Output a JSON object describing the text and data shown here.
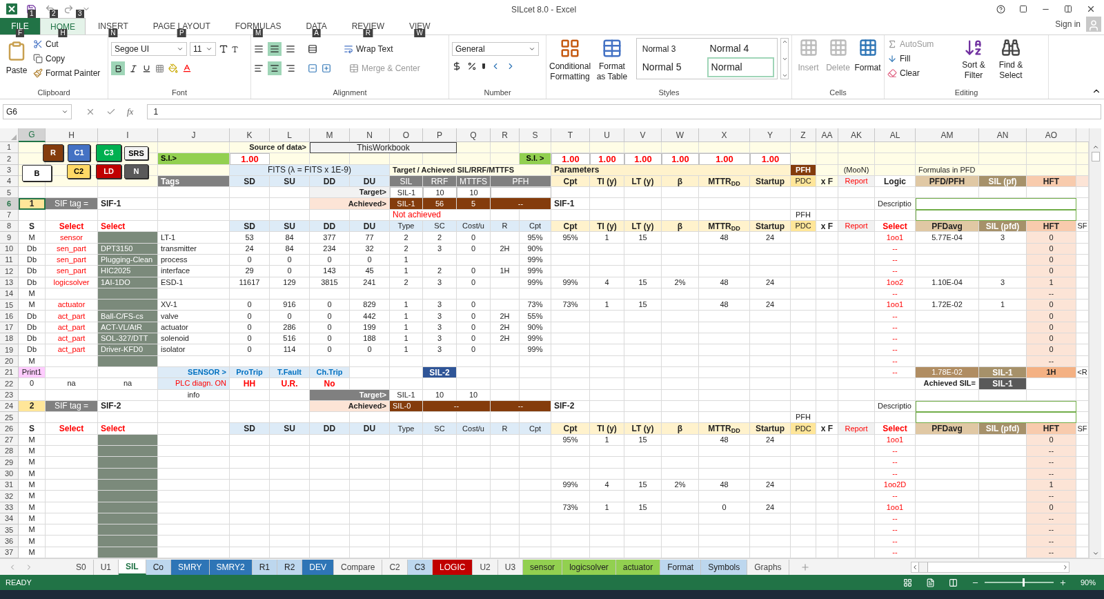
{
  "window": {
    "title": "SILcet 8.0 - Excel",
    "sign_in": "Sign in",
    "quick_access_keytips": [
      "1",
      "2",
      "3"
    ]
  },
  "tabs": [
    {
      "label": "FILE",
      "keytip": "F",
      "kind": "file",
      "selected": false
    },
    {
      "label": "HOME",
      "keytip": "H",
      "kind": "tab",
      "selected": true
    },
    {
      "label": "INSERT",
      "keytip": "N",
      "kind": "tab",
      "selected": false
    },
    {
      "label": "PAGE LAYOUT",
      "keytip": "P",
      "kind": "tab",
      "selected": false
    },
    {
      "label": "FORMULAS",
      "keytip": "M",
      "kind": "tab",
      "selected": false
    },
    {
      "label": "DATA",
      "keytip": "A",
      "kind": "tab",
      "selected": false
    },
    {
      "label": "REVIEW",
      "keytip": "R",
      "kind": "tab",
      "selected": false
    },
    {
      "label": "VIEW",
      "keytip": "W",
      "kind": "tab",
      "selected": false
    }
  ],
  "ribbon": {
    "clipboard": {
      "label": "Clipboard",
      "paste": "Paste",
      "cut": "Cut",
      "copy": "Copy",
      "format_painter": "Format Painter"
    },
    "font": {
      "label": "Font",
      "family": "Segoe UI",
      "size": "11",
      "bold": true
    },
    "alignment": {
      "label": "Alignment",
      "wrap_text": "Wrap Text",
      "merge": "Merge & Center",
      "middle": true,
      "center": true
    },
    "number": {
      "label": "Number",
      "format": "General"
    },
    "styles": {
      "label": "Styles",
      "conditional": "Conditional Formatting",
      "format_table": "Format as Table",
      "items": [
        {
          "label": "Normal 3",
          "selected": false
        },
        {
          "label": "Normal 4",
          "selected": false
        },
        {
          "label": "Normal 5",
          "selected": false
        },
        {
          "label": "Normal",
          "selected": true
        }
      ]
    },
    "cells": {
      "label": "Cells",
      "items": [
        {
          "label": "Insert",
          "disabled": true
        },
        {
          "label": "Delete",
          "disabled": true
        },
        {
          "label": "Format",
          "disabled": false
        }
      ]
    },
    "editing": {
      "label": "Editing",
      "autosum": "AutoSum",
      "fill": "Fill",
      "clear": "Clear",
      "sort": "Sort & Filter",
      "find": "Find & Select"
    }
  },
  "formula_bar": {
    "name_box": "G6",
    "function_label": "fx",
    "value": "1"
  },
  "columns": [
    {
      "letter": "G",
      "selected": true
    },
    {
      "letter": "H",
      "selected": false
    },
    {
      "letter": "I",
      "selected": false
    },
    {
      "letter": "J",
      "selected": false
    },
    {
      "letter": "K",
      "selected": false
    },
    {
      "letter": "L",
      "selected": false
    },
    {
      "letter": "M",
      "selected": false
    },
    {
      "letter": "N",
      "selected": false
    },
    {
      "letter": "O",
      "selected": false
    },
    {
      "letter": "P",
      "selected": false
    },
    {
      "letter": "Q",
      "selected": false
    },
    {
      "letter": "R",
      "selected": false
    },
    {
      "letter": "S",
      "selected": false
    },
    {
      "letter": "T",
      "selected": false
    },
    {
      "letter": "U",
      "selected": false
    },
    {
      "letter": "V",
      "selected": false
    },
    {
      "letter": "W",
      "selected": false
    },
    {
      "letter": "X",
      "selected": false
    },
    {
      "letter": "Y",
      "selected": false
    },
    {
      "letter": "Z",
      "selected": false
    },
    {
      "letter": "AA",
      "selected": false
    },
    {
      "letter": "AK",
      "selected": false
    },
    {
      "letter": "AL",
      "selected": false
    },
    {
      "letter": "AM",
      "selected": false
    },
    {
      "letter": "AN",
      "selected": false
    },
    {
      "letter": "AO",
      "selected": false
    }
  ],
  "sheet_buttons": [
    {
      "label": "R",
      "color": "#843c0c"
    },
    {
      "label": "C1",
      "color": "#4472c4"
    },
    {
      "label": "C3",
      "color": "#00b050"
    },
    {
      "label": "SRS",
      "color": "#f2f2f2"
    },
    {
      "label": "B",
      "color": "#ffffff"
    },
    {
      "label": "C2",
      "color": "#ffd966"
    },
    {
      "label": "LD",
      "color": "#c00000"
    },
    {
      "label": "N",
      "color": "#595959"
    }
  ],
  "rows": [
    {
      "n": "1",
      "kind": "banner",
      "selected": false,
      "cells": [
        null,
        null,
        null,
        null,
        {
          "text": "Source of data>",
          "kind": "right"
        },
        {
          "kind": "cont"
        },
        {
          "text": "ThisWorkbook",
          "kind": "box"
        },
        {
          "kind": "cont"
        },
        {
          "kind": "cont"
        },
        {
          "kind": "cont"
        }
      ]
    },
    {
      "n": "2",
      "kind": "banner",
      "selected": false,
      "cells": [
        null,
        null,
        null,
        {
          "text": "S.I.>",
          "kind": "green"
        },
        {
          "text": "1.00",
          "kind": "input"
        },
        null,
        null,
        null,
        null,
        null,
        null,
        null,
        {
          "text": "S.I. >",
          "kind": "green"
        },
        {
          "text": "1.00",
          "kind": "input"
        },
        {
          "text": "1.00",
          "kind": "input"
        },
        {
          "text": "1.00",
          "kind": "input"
        },
        {
          "text": "1.00",
          "kind": "input"
        },
        {
          "text": "1.00",
          "kind": "input"
        },
        {
          "text": "1.00",
          "kind": "input"
        }
      ]
    },
    {
      "n": "3",
      "kind": "banner",
      "selected": false,
      "cells": [
        null,
        null,
        null,
        null,
        {
          "text": "FITS  (λ = FITS x 1E-9)",
          "kind": "fits"
        },
        {
          "kind": "cont"
        },
        {
          "kind": "cont"
        },
        {
          "kind": "cont"
        },
        {
          "text": "Target / Achieved SIL/RRF/MTTFS",
          "kind": "boldsmall"
        },
        {
          "kind": "cont"
        },
        {
          "kind": "cont"
        },
        {
          "kind": "cont"
        },
        {
          "kind": "cont"
        },
        {
          "text": "Parameters",
          "kind": "creamleft"
        },
        {
          "kind": "cont"
        },
        {
          "kind": "cont"
        },
        {
          "kind": "cont"
        },
        {
          "kind": "cont"
        },
        {
          "kind": "cont"
        },
        {
          "text": "PFH",
          "kind": "brownbold"
        },
        null,
        {
          "text": "(MooN)",
          "kind": "small"
        },
        null,
        {
          "text": "Formulas in PFD",
          "kind": "smallleft"
        },
        {
          "kind": "cont"
        }
      ]
    },
    {
      "n": "4",
      "kind": "banner",
      "selected": false,
      "cells": [
        null,
        null,
        null,
        {
          "text": "Tags",
          "kind": "dark"
        },
        {
          "text": "SD",
          "kind": "hdr"
        },
        {
          "text": "SU",
          "kind": "hdr"
        },
        {
          "text": "DD",
          "kind": "hdr"
        },
        {
          "text": "DU",
          "kind": "hdr"
        },
        {
          "text": "SIL",
          "kind": "ghdr"
        },
        {
          "text": "RRF",
          "kind": "ghdr"
        },
        {
          "text": "MTTFS",
          "kind": "ghdr"
        },
        {
          "text": "PFH",
          "kind": "ghdr"
        },
        {
          "kind": "cont"
        },
        {
          "text": "Cpt",
          "kind": "cream"
        },
        {
          "text": "TI (y)",
          "kind": "cream"
        },
        {
          "text": "LT (y)",
          "kind": "cream"
        },
        {
          "text": "β",
          "kind": "cream"
        },
        {
          "text": "MTTR$_{DD}$",
          "kind": "cream"
        },
        {
          "text": "Startup",
          "kind": "cream"
        },
        {
          "text": "PDC",
          "kind": "pdc"
        },
        {
          "text": "x F",
          "kind": "bold"
        },
        {
          "text": "Report",
          "kind": "report"
        },
        {
          "text": "Logic",
          "kind": "boldwhite"
        },
        {
          "text": "PFD/PFH",
          "kind": "tan"
        },
        {
          "text": "SIL (pf)",
          "kind": "olive"
        },
        {
          "text": "HFT",
          "kind": "salmon"
        },
        {
          "kind": "pale"
        }
      ]
    },
    {
      "n": "5",
      "kind": "plain",
      "selected": false,
      "cells": [
        null,
        null,
        null,
        null,
        null,
        null,
        {
          "text": "Target>",
          "kind": "graylabel"
        },
        {
          "kind": "cont"
        },
        {
          "text": "SIL-1",
          "kind": "boxed"
        },
        {
          "text": "10",
          "kind": "boxed"
        },
        {
          "text": "10",
          "kind": "boxed"
        },
        {
          "kind": "boxed"
        },
        {
          "kind": "cont"
        }
      ]
    },
    {
      "n": "6",
      "kind": "plain",
      "selected": true,
      "cells": [
        {
          "text": "1",
          "kind": "num"
        },
        {
          "text": "SIF tag =",
          "kind": "darklabel"
        },
        {
          "text": "SIF-1",
          "kind": "boldleft"
        },
        null,
        null,
        null,
        {
          "text": "Achieved>",
          "kind": "peach"
        },
        {
          "kind": "cont"
        },
        {
          "text": "SIL-1",
          "kind": "brown"
        },
        {
          "text": "56",
          "kind": "brown"
        },
        {
          "text": "5",
          "kind": "brown"
        },
        {
          "text": "--",
          "kind": "brown"
        },
        {
          "kind": "cont"
        },
        {
          "text": "SIF-1",
          "kind": "boldleft"
        },
        null,
        null,
        null,
        null,
        null,
        null,
        null,
        null,
        {
          "text": "Descriptio",
          "kind": "smallleft"
        },
        {
          "kind": "descbox"
        },
        {
          "kind": "cont"
        },
        {
          "kind": "cont"
        }
      ]
    },
    {
      "n": "7",
      "kind": "plain",
      "selected": false,
      "cells": [
        null,
        null,
        null,
        null,
        null,
        null,
        null,
        null,
        {
          "text": "Not achieved",
          "kind": "redleft"
        },
        {
          "kind": "cont"
        },
        {
          "kind": "cont"
        },
        null,
        null,
        null,
        null,
        null,
        null,
        null,
        null,
        {
          "text": "PFH",
          "kind": "small"
        },
        null,
        null,
        null,
        {
          "kind": "descbox"
        },
        {
          "kind": "cont"
        },
        {
          "kind": "cont"
        }
      ]
    },
    {
      "n": "8",
      "kind": "plain",
      "selected": false,
      "cells": [
        {
          "text": "S",
          "kind": "bold"
        },
        {
          "text": "Select",
          "kind": "redbold"
        },
        {
          "text": "Select",
          "kind": "redbold"
        },
        null,
        {
          "text": "SD",
          "kind": "hdr"
        },
        {
          "text": "SU",
          "kind": "hdr"
        },
        {
          "text": "DD",
          "kind": "hdr"
        },
        {
          "text": "DU",
          "kind": "hdr"
        },
        {
          "text": "Type",
          "kind": "hdrplain"
        },
        {
          "text": "SC",
          "kind": "hdrplain"
        },
        {
          "text": "Cost/u",
          "kind": "hdrplain"
        },
        {
          "text": "R",
          "kind": "hdrplain"
        },
        {
          "text": "Cpt",
          "kind": "hdrplain"
        },
        {
          "text": "Cpt",
          "kind": "cream"
        },
        {
          "text": "TI (y)",
          "kind": "cream"
        },
        {
          "text": "LT (y)",
          "kind": "cream"
        },
        {
          "text": "β",
          "kind": "cream"
        },
        {
          "text": "MTTR$_{DD}$",
          "kind": "cream"
        },
        {
          "text": "Startup",
          "kind": "cream"
        },
        {
          "text": "PDC",
          "kind": "pdc"
        },
        {
          "text": "x F",
          "kind": "bold"
        },
        {
          "text": "Report",
          "kind": "report"
        },
        {
          "text": "Select",
          "kind": "redbold"
        },
        {
          "text": "PFDavg",
          "kind": "tan"
        },
        {
          "text": "SIL (pfd)",
          "kind": "olive"
        },
        {
          "text": "HFT",
          "kind": "salmon"
        },
        {
          "text": "SF",
          "kind": "small"
        }
      ]
    },
    {
      "n": "9",
      "kind": "plain",
      "selected": false,
      "cells": [
        "M",
        {
          "text": "sensor",
          "kind": "red"
        },
        {
          "kind": "shade"
        },
        "LT-1",
        "53",
        "84",
        "377",
        "77",
        "2",
        "2",
        "0",
        null,
        "95%",
        "95%",
        "1",
        "15",
        null,
        "48",
        "24",
        null,
        null,
        null,
        {
          "text": "1oo1",
          "kind": "red"
        },
        "5.77E-04",
        "3",
        {
          "text": "0",
          "kind": "pale"
        }
      ]
    },
    {
      "n": "10",
      "kind": "plain",
      "selected": false,
      "cells": [
        "Db",
        {
          "text": "sen_part",
          "kind": "red"
        },
        {
          "text": "DPT3150",
          "kind": "shade"
        },
        "transmitter",
        "24",
        "84",
        "234",
        "32",
        "2",
        "3",
        "0",
        "2H",
        "90%",
        null,
        null,
        null,
        null,
        null,
        null,
        null,
        null,
        null,
        {
          "text": "--",
          "kind": "red"
        },
        null,
        null,
        {
          "text": "0",
          "kind": "pale"
        }
      ]
    },
    {
      "n": "11",
      "kind": "plain",
      "selected": false,
      "cells": [
        "Db",
        {
          "text": "sen_part",
          "kind": "red"
        },
        {
          "text": "Plugging-Clean",
          "kind": "shade"
        },
        "process",
        "0",
        "0",
        "0",
        "0",
        "1",
        null,
        null,
        null,
        "99%",
        null,
        null,
        null,
        null,
        null,
        null,
        null,
        null,
        null,
        {
          "text": "--",
          "kind": "red"
        },
        null,
        null,
        {
          "text": "0",
          "kind": "pale"
        }
      ]
    },
    {
      "n": "12",
      "kind": "plain",
      "selected": false,
      "cells": [
        "Db",
        {
          "text": "sen_part",
          "kind": "red"
        },
        {
          "text": "HIC2025",
          "kind": "shade"
        },
        "interface",
        "29",
        "0",
        "143",
        "45",
        "1",
        "2",
        "0",
        "1H",
        "99%",
        null,
        null,
        null,
        null,
        null,
        null,
        null,
        null,
        null,
        {
          "text": "--",
          "kind": "red"
        },
        null,
        null,
        {
          "text": "0",
          "kind": "pale"
        }
      ]
    },
    {
      "n": "13",
      "kind": "plain",
      "selected": false,
      "cells": [
        "Db",
        {
          "text": "logicsolver",
          "kind": "red"
        },
        {
          "text": "1AI-1DO",
          "kind": "shade"
        },
        "ESD-1",
        "11617",
        "129",
        "3815",
        "241",
        "2",
        "3",
        "0",
        null,
        "99%",
        "99%",
        "4",
        "15",
        "2%",
        "48",
        "24",
        null,
        null,
        null,
        {
          "text": "1oo2",
          "kind": "red"
        },
        "1.10E-04",
        "3",
        {
          "text": "1",
          "kind": "pale"
        }
      ]
    },
    {
      "n": "14",
      "kind": "plain",
      "selected": false,
      "cells": [
        "M",
        null,
        {
          "kind": "shade"
        },
        null,
        null,
        null,
        null,
        null,
        null,
        null,
        null,
        null,
        null,
        null,
        null,
        null,
        null,
        null,
        null,
        null,
        null,
        null,
        {
          "text": "--",
          "kind": "red"
        },
        null,
        null,
        {
          "text": "--",
          "kind": "pale"
        }
      ]
    },
    {
      "n": "15",
      "kind": "plain",
      "selected": false,
      "cells": [
        "M",
        {
          "text": "actuator",
          "kind": "red"
        },
        {
          "kind": "shade"
        },
        "XV-1",
        "0",
        "916",
        "0",
        "829",
        "1",
        "3",
        "0",
        null,
        "73%",
        "73%",
        "1",
        "15",
        null,
        "48",
        "24",
        null,
        null,
        null,
        {
          "text": "1oo1",
          "kind": "red"
        },
        "1.72E-02",
        "1",
        {
          "text": "0",
          "kind": "pale"
        }
      ]
    },
    {
      "n": "16",
      "kind": "plain",
      "selected": false,
      "cells": [
        "Db",
        {
          "text": "act_part",
          "kind": "red"
        },
        {
          "text": "Ball-C/FS-cs",
          "kind": "shade"
        },
        "valve",
        "0",
        "0",
        "0",
        "442",
        "1",
        "3",
        "0",
        "2H",
        "55%",
        null,
        null,
        null,
        null,
        null,
        null,
        null,
        null,
        null,
        {
          "text": "--",
          "kind": "red"
        },
        null,
        null,
        {
          "text": "0",
          "kind": "pale"
        }
      ]
    },
    {
      "n": "17",
      "kind": "plain",
      "selected": false,
      "cells": [
        "Db",
        {
          "text": "act_part",
          "kind": "red"
        },
        {
          "text": "ACT-VL/AtR",
          "kind": "shade"
        },
        "actuator",
        "0",
        "286",
        "0",
        "199",
        "1",
        "3",
        "0",
        "2H",
        "90%",
        null,
        null,
        null,
        null,
        null,
        null,
        null,
        null,
        null,
        {
          "text": "--",
          "kind": "red"
        },
        null,
        null,
        {
          "text": "0",
          "kind": "pale"
        }
      ]
    },
    {
      "n": "18",
      "kind": "plain",
      "selected": false,
      "cells": [
        "Db",
        {
          "text": "act_part",
          "kind": "red"
        },
        {
          "text": "SOL-327/DTT",
          "kind": "shade"
        },
        "solenoid",
        "0",
        "516",
        "0",
        "188",
        "1",
        "3",
        "0",
        "2H",
        "99%",
        null,
        null,
        null,
        null,
        null,
        null,
        null,
        null,
        null,
        {
          "text": "--",
          "kind": "red"
        },
        null,
        null,
        {
          "text": "0",
          "kind": "pale"
        }
      ]
    },
    {
      "n": "19",
      "kind": "plain",
      "selected": false,
      "cells": [
        "Db",
        {
          "text": "act_part",
          "kind": "red"
        },
        {
          "text": "Driver-KFD0",
          "kind": "shade"
        },
        "isolator",
        "0",
        "114",
        "0",
        "0",
        "1",
        "3",
        "0",
        null,
        "99%",
        null,
        null,
        null,
        null,
        null,
        null,
        null,
        null,
        null,
        {
          "text": "--",
          "kind": "red"
        },
        null,
        null,
        {
          "text": "0",
          "kind": "pale"
        }
      ]
    },
    {
      "n": "20",
      "kind": "plain",
      "selected": false,
      "cells": [
        "M",
        null,
        {
          "kind": "shade"
        },
        null,
        null,
        null,
        null,
        null,
        null,
        null,
        null,
        null,
        null,
        null,
        null,
        null,
        null,
        null,
        null,
        null,
        null,
        null,
        {
          "text": "--",
          "kind": "red"
        },
        null,
        null,
        {
          "text": "--",
          "kind": "pale"
        }
      ]
    },
    {
      "n": "21",
      "kind": "plain",
      "selected": false,
      "cells": [
        {
          "text": "Print1",
          "kind": "pink"
        },
        null,
        null,
        {
          "text": "SENSOR >",
          "kind": "blueright"
        },
        {
          "text": "ProTrip",
          "kind": "blue"
        },
        {
          "text": "T.Fault",
          "kind": "blue"
        },
        {
          "text": "Ch.Trip",
          "kind": "blue"
        },
        null,
        null,
        {
          "text": "SIL-2",
          "kind": "navy"
        },
        null,
        null,
        null,
        null,
        null,
        null,
        null,
        null,
        null,
        null,
        null,
        null,
        {
          "text": "--",
          "kind": "red"
        },
        {
          "text": "1.78E-02",
          "kind": "sum"
        },
        {
          "text": "SIL-1",
          "kind": "olive"
        },
        {
          "text": "1H",
          "kind": "salmonbar"
        },
        {
          "text": "<R",
          "kind": "small"
        }
      ]
    },
    {
      "n": "22",
      "kind": "plain",
      "selected": false,
      "cells": [
        "0",
        "na",
        {
          "text": "na",
          "kind": "center"
        },
        {
          "text": "PLC diagn. ON",
          "kind": "redright"
        },
        {
          "text": "HH",
          "kind": "redbold"
        },
        {
          "text": "U.R.",
          "kind": "redbold"
        },
        {
          "text": "No",
          "kind": "redbold"
        },
        null,
        null,
        null,
        null,
        null,
        null,
        null,
        null,
        null,
        null,
        null,
        null,
        null,
        null,
        null,
        null,
        {
          "text": "Achieved SIL=",
          "kind": "right"
        },
        {
          "text": "SIL-1",
          "kind": "achv"
        }
      ]
    },
    {
      "n": "23",
      "kind": "plain",
      "selected": false,
      "cells": [
        null,
        null,
        null,
        {
          "text": "info",
          "kind": "center"
        },
        null,
        null,
        {
          "text": "Target>",
          "kind": "darkright"
        },
        {
          "kind": "cont"
        },
        "SIL-1",
        "10",
        "10"
      ]
    },
    {
      "n": "24",
      "kind": "plain",
      "selected": false,
      "cells": [
        {
          "text": "2",
          "kind": "num"
        },
        {
          "text": "SIF tag =",
          "kind": "darklabel"
        },
        {
          "text": "SIF-2",
          "kind": "boldleft"
        },
        null,
        null,
        null,
        {
          "text": "Achieved>",
          "kind": "peach"
        },
        {
          "kind": "cont"
        },
        {
          "text": "SIL-0",
          "kind": "brownleft"
        },
        {
          "text": "--",
          "kind": "brown"
        },
        {
          "kind": "cont"
        },
        {
          "text": "--",
          "kind": "brown"
        },
        {
          "kind": "cont"
        },
        {
          "text": "SIF-2",
          "kind": "boldleft"
        },
        null,
        null,
        null,
        null,
        null,
        null,
        null,
        null,
        {
          "text": "Descriptio",
          "kind": "smallleft"
        },
        {
          "kind": "descbox"
        },
        {
          "kind": "cont"
        },
        {
          "kind": "cont"
        }
      ]
    },
    {
      "n": "25",
      "kind": "plain",
      "selected": false,
      "cells": [
        null,
        null,
        null,
        null,
        null,
        null,
        null,
        null,
        null,
        null,
        null,
        null,
        null,
        null,
        null,
        null,
        null,
        null,
        null,
        {
          "text": "PFH",
          "kind": "small"
        },
        null,
        null,
        null,
        {
          "kind": "descbox"
        },
        {
          "kind": "cont"
        },
        {
          "kind": "cont"
        }
      ]
    },
    {
      "n": "26",
      "kind": "plain",
      "selected": false,
      "cells": [
        {
          "text": "S",
          "kind": "bold"
        },
        {
          "text": "Select",
          "kind": "redbold"
        },
        {
          "text": "Select",
          "kind": "redbold"
        },
        null,
        {
          "text": "SD",
          "kind": "hdr"
        },
        {
          "text": "SU",
          "kind": "hdr"
        },
        {
          "text": "DD",
          "kind": "hdr"
        },
        {
          "text": "DU",
          "kind": "hdr"
        },
        {
          "text": "Type",
          "kind": "hdrplain"
        },
        {
          "text": "SC",
          "kind": "hdrplain"
        },
        {
          "text": "Cost/u",
          "kind": "hdrplain"
        },
        {
          "text": "R",
          "kind": "hdrplain"
        },
        {
          "text": "Cpt",
          "kind": "hdrplain"
        },
        {
          "text": "Cpt",
          "kind": "cream"
        },
        {
          "text": "TI (y)",
          "kind": "cream"
        },
        {
          "text": "LT (y)",
          "kind": "cream"
        },
        {
          "text": "β",
          "kind": "cream"
        },
        {
          "text": "MTTR$_{DD}$",
          "kind": "cream"
        },
        {
          "text": "Startup",
          "kind": "cream"
        },
        {
          "text": "PDC",
          "kind": "pdc"
        },
        {
          "text": "x F",
          "kind": "bold"
        },
        {
          "text": "Report",
          "kind": "report"
        },
        {
          "text": "Select",
          "kind": "redbold"
        },
        {
          "text": "PFDavg",
          "kind": "tan"
        },
        {
          "text": "SIL (pfd)",
          "kind": "olive"
        },
        {
          "text": "HFT",
          "kind": "salmon"
        },
        {
          "text": "SF",
          "kind": "small"
        }
      ]
    },
    {
      "n": "27",
      "kind": "plain",
      "selected": false,
      "cells": [
        "M",
        null,
        {
          "kind": "shade"
        },
        null,
        null,
        null,
        null,
        null,
        null,
        null,
        null,
        null,
        null,
        "95%",
        "1",
        "15",
        null,
        "48",
        "24",
        null,
        null,
        null,
        {
          "text": "1oo1",
          "kind": "red"
        },
        null,
        null,
        {
          "text": "0",
          "kind": "pale"
        }
      ]
    },
    {
      "n": "28",
      "kind": "plain",
      "selected": false,
      "cells": [
        "M",
        null,
        {
          "kind": "shade"
        },
        null,
        null,
        null,
        null,
        null,
        null,
        null,
        null,
        null,
        null,
        null,
        null,
        null,
        null,
        null,
        null,
        null,
        null,
        null,
        {
          "text": "--",
          "kind": "red"
        },
        null,
        null,
        {
          "text": "--",
          "kind": "pale"
        }
      ]
    },
    {
      "n": "29",
      "kind": "plain",
      "selected": false,
      "cells": [
        "M",
        null,
        {
          "kind": "shade"
        },
        null,
        null,
        null,
        null,
        null,
        null,
        null,
        null,
        null,
        null,
        null,
        null,
        null,
        null,
        null,
        null,
        null,
        null,
        null,
        {
          "text": "--",
          "kind": "red"
        },
        null,
        null,
        {
          "text": "--",
          "kind": "pale"
        }
      ]
    },
    {
      "n": "30",
      "kind": "plain",
      "selected": false,
      "cells": [
        "M",
        null,
        {
          "kind": "shade"
        },
        null,
        null,
        null,
        null,
        null,
        null,
        null,
        null,
        null,
        null,
        null,
        null,
        null,
        null,
        null,
        null,
        null,
        null,
        null,
        {
          "text": "--",
          "kind": "red"
        },
        null,
        null,
        {
          "text": "--",
          "kind": "pale"
        }
      ]
    },
    {
      "n": "31",
      "kind": "plain",
      "selected": false,
      "cells": [
        "M",
        null,
        {
          "kind": "shade"
        },
        null,
        null,
        null,
        null,
        null,
        null,
        null,
        null,
        null,
        null,
        "99%",
        "4",
        "15",
        "2%",
        "48",
        "24",
        null,
        null,
        null,
        {
          "text": "1oo2D",
          "kind": "red"
        },
        null,
        null,
        {
          "text": "1",
          "kind": "pale"
        }
      ]
    },
    {
      "n": "32",
      "kind": "plain",
      "selected": false,
      "cells": [
        "M",
        null,
        {
          "kind": "shade"
        },
        null,
        null,
        null,
        null,
        null,
        null,
        null,
        null,
        null,
        null,
        null,
        null,
        null,
        null,
        null,
        null,
        null,
        null,
        null,
        {
          "text": "--",
          "kind": "red"
        },
        null,
        null,
        {
          "text": "--",
          "kind": "pale"
        }
      ]
    },
    {
      "n": "33",
      "kind": "plain",
      "selected": false,
      "cells": [
        "M",
        null,
        {
          "kind": "shade"
        },
        null,
        null,
        null,
        null,
        null,
        null,
        null,
        null,
        null,
        null,
        "73%",
        "1",
        "15",
        null,
        "0",
        "24",
        null,
        null,
        null,
        {
          "text": "1oo1",
          "kind": "red"
        },
        null,
        null,
        {
          "text": "0",
          "kind": "pale"
        }
      ]
    },
    {
      "n": "34",
      "kind": "plain",
      "selected": false,
      "cells": [
        "M",
        null,
        {
          "kind": "shade"
        },
        null,
        null,
        null,
        null,
        null,
        null,
        null,
        null,
        null,
        null,
        null,
        null,
        null,
        null,
        null,
        null,
        null,
        null,
        null,
        {
          "text": "--",
          "kind": "red"
        },
        null,
        null,
        {
          "text": "--",
          "kind": "pale"
        }
      ]
    },
    {
      "n": "35",
      "kind": "plain",
      "selected": false,
      "cells": [
        "M",
        null,
        {
          "kind": "shade"
        },
        null,
        null,
        null,
        null,
        null,
        null,
        null,
        null,
        null,
        null,
        null,
        null,
        null,
        null,
        null,
        null,
        null,
        null,
        null,
        {
          "text": "--",
          "kind": "red"
        },
        null,
        null,
        {
          "text": "--",
          "kind": "pale"
        }
      ]
    },
    {
      "n": "36",
      "kind": "plain",
      "selected": false,
      "cells": [
        "M",
        null,
        {
          "kind": "shade"
        },
        null,
        null,
        null,
        null,
        null,
        null,
        null,
        null,
        null,
        null,
        null,
        null,
        null,
        null,
        null,
        null,
        null,
        null,
        null,
        {
          "text": "--",
          "kind": "red"
        },
        null,
        null,
        {
          "text": "--",
          "kind": "pale"
        }
      ]
    },
    {
      "n": "37",
      "kind": "plain",
      "selected": false,
      "cells": [
        "M",
        null,
        {
          "kind": "shade"
        },
        null,
        null,
        null,
        null,
        null,
        null,
        null,
        null,
        null,
        null,
        null,
        null,
        null,
        null,
        null,
        null,
        null,
        null,
        null,
        {
          "text": "--",
          "kind": "red"
        },
        null,
        null,
        {
          "text": "--",
          "kind": "pale"
        }
      ]
    }
  ],
  "sheet_tabs": [
    {
      "label": "S0",
      "selected": false
    },
    {
      "label": "U1",
      "selected": false
    },
    {
      "label": "SIL",
      "selected": true
    },
    {
      "label": "Co",
      "selected": false,
      "color": "#bdd7ee"
    },
    {
      "label": "SMRY",
      "selected": false,
      "color": "#2e75b6"
    },
    {
      "label": "SMRY2",
      "selected": false,
      "color": "#2e75b6"
    },
    {
      "label": "R1",
      "selected": false,
      "color": "#bdd7ee"
    },
    {
      "label": "R2",
      "selected": false,
      "color": "#bdd7ee"
    },
    {
      "label": "DEV",
      "selected": false,
      "color": "#2e75b6"
    },
    {
      "label": "Compare",
      "selected": false
    },
    {
      "label": "C2",
      "selected": false
    },
    {
      "label": "C3",
      "selected": false,
      "color": "#bdd7ee"
    },
    {
      "label": "LOGIC",
      "selected": false,
      "color": "#c00000"
    },
    {
      "label": "U2",
      "selected": false
    },
    {
      "label": "U3",
      "selected": false
    },
    {
      "label": "sensor",
      "selected": false,
      "color": "#92d050"
    },
    {
      "label": "logicsolver",
      "selected": false,
      "color": "#92d050"
    },
    {
      "label": "actuator",
      "selected": false,
      "color": "#92d050"
    },
    {
      "label": "Format",
      "selected": false,
      "color": "#bdd7ee"
    },
    {
      "label": "Symbols",
      "selected": false,
      "color": "#bdd7ee"
    },
    {
      "label": "Graphs",
      "selected": false
    }
  ],
  "status_bar": {
    "status": "READY",
    "zoom": "90%",
    "zoom_slider": {
      "level": 0.55
    }
  }
}
